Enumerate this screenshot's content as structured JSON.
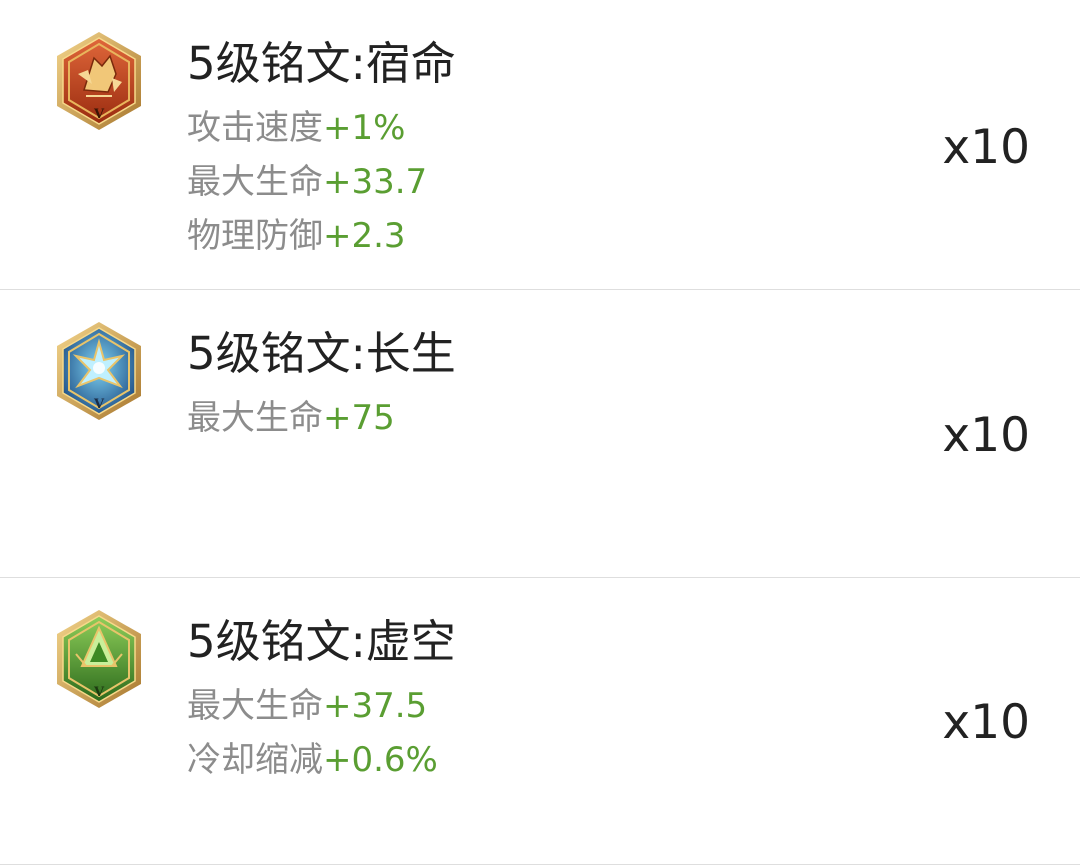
{
  "items": [
    {
      "title": "5级铭文:宿命",
      "count": "x10",
      "icon": "fate-inscription-icon",
      "color": "#b8401c",
      "attributes": [
        {
          "name": "攻击速度",
          "value": "+1%"
        },
        {
          "name": "最大生命",
          "value": "+33.7"
        },
        {
          "name": "物理防御",
          "value": "+2.3"
        }
      ]
    },
    {
      "title": "5级铭文:长生",
      "count": "x10",
      "icon": "longevity-inscription-icon",
      "color": "#2f6fa8",
      "attributes": [
        {
          "name": "最大生命",
          "value": "+75"
        }
      ]
    },
    {
      "title": "5级铭文:虚空",
      "count": "x10",
      "icon": "void-inscription-icon",
      "color": "#3f8f2a",
      "attributes": [
        {
          "name": "最大生命",
          "value": "+37.5"
        },
        {
          "name": "冷却缩减",
          "value": "+0.6%"
        }
      ]
    }
  ],
  "icon_level_mark": "V",
  "colors": {
    "attribute_name": "#8c8c8c",
    "attribute_value": "#5a9e32",
    "title": "#222222",
    "divider": "#dedede"
  }
}
